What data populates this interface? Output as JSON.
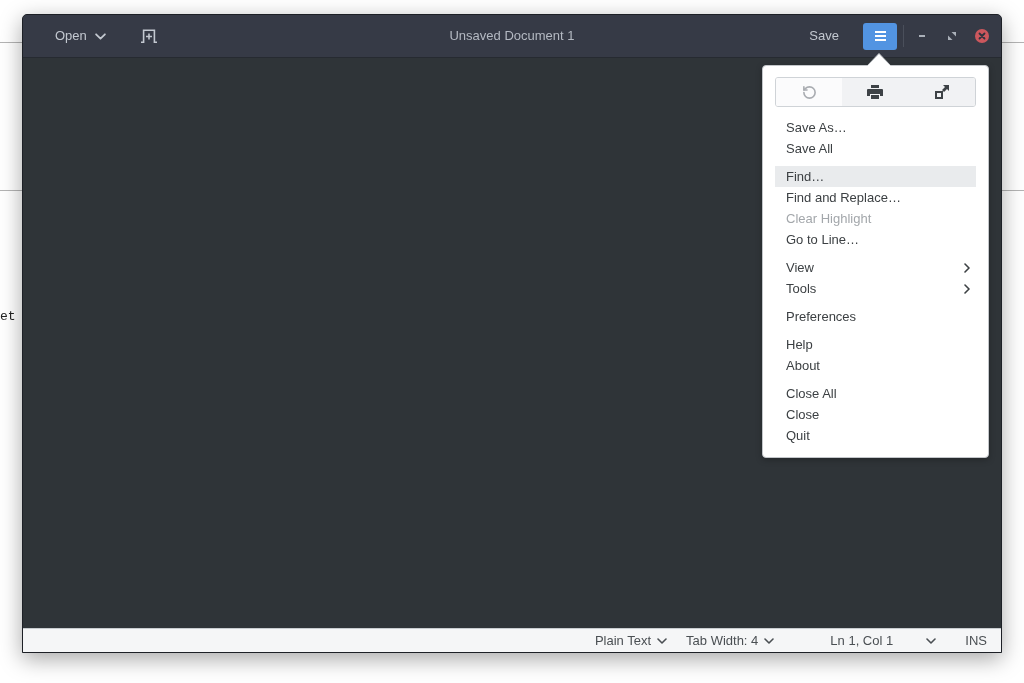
{
  "background_window": {
    "text_fragment": "et"
  },
  "window": {
    "header_bar": {
      "open_button": {
        "label": "Open"
      },
      "title": "Unsaved Document 1",
      "save_button": {
        "label": "Save"
      },
      "menu_button": {
        "active": true
      }
    },
    "menu_popover": {
      "toolbar": [
        {
          "kind": "undo",
          "disabled": true
        },
        {
          "kind": "print",
          "disabled": false
        },
        {
          "kind": "fullscreen",
          "disabled": false
        }
      ],
      "sections": [
        {
          "items": [
            {
              "label": "Save As…",
              "kind": "action",
              "selected": false,
              "disabled": false
            },
            {
              "label": "Save All",
              "kind": "action",
              "selected": false,
              "disabled": false
            }
          ]
        },
        {
          "items": [
            {
              "label": "Find…",
              "kind": "action",
              "selected": true,
              "disabled": false
            },
            {
              "label": "Find and Replace…",
              "kind": "action",
              "selected": false,
              "disabled": false
            },
            {
              "label": "Clear Highlight",
              "kind": "action",
              "selected": false,
              "disabled": true
            },
            {
              "label": "Go to Line…",
              "kind": "action",
              "selected": false,
              "disabled": false
            }
          ]
        },
        {
          "items": [
            {
              "label": "View",
              "kind": "submenu",
              "selected": false,
              "disabled": false
            },
            {
              "label": "Tools",
              "kind": "submenu",
              "selected": false,
              "disabled": false
            }
          ]
        },
        {
          "items": [
            {
              "label": "Preferences",
              "kind": "action",
              "selected": false,
              "disabled": false
            }
          ]
        },
        {
          "items": [
            {
              "label": "Help",
              "kind": "action",
              "selected": false,
              "disabled": false
            },
            {
              "label": "About",
              "kind": "action",
              "selected": false,
              "disabled": false
            }
          ]
        },
        {
          "items": [
            {
              "label": "Close All",
              "kind": "action",
              "selected": false,
              "disabled": false
            },
            {
              "label": "Close",
              "kind": "action",
              "selected": false,
              "disabled": false
            },
            {
              "label": "Quit",
              "kind": "action",
              "selected": false,
              "disabled": false
            }
          ]
        }
      ]
    },
    "status_bar": {
      "items": [
        {
          "kind": "dropdown",
          "label": "Plain Text"
        },
        {
          "kind": "dropdown",
          "label": "Tab Width: 4"
        },
        {
          "kind": "position",
          "label": "Ln 1, Col 1"
        },
        {
          "kind": "label",
          "label": "INS"
        }
      ]
    }
  }
}
